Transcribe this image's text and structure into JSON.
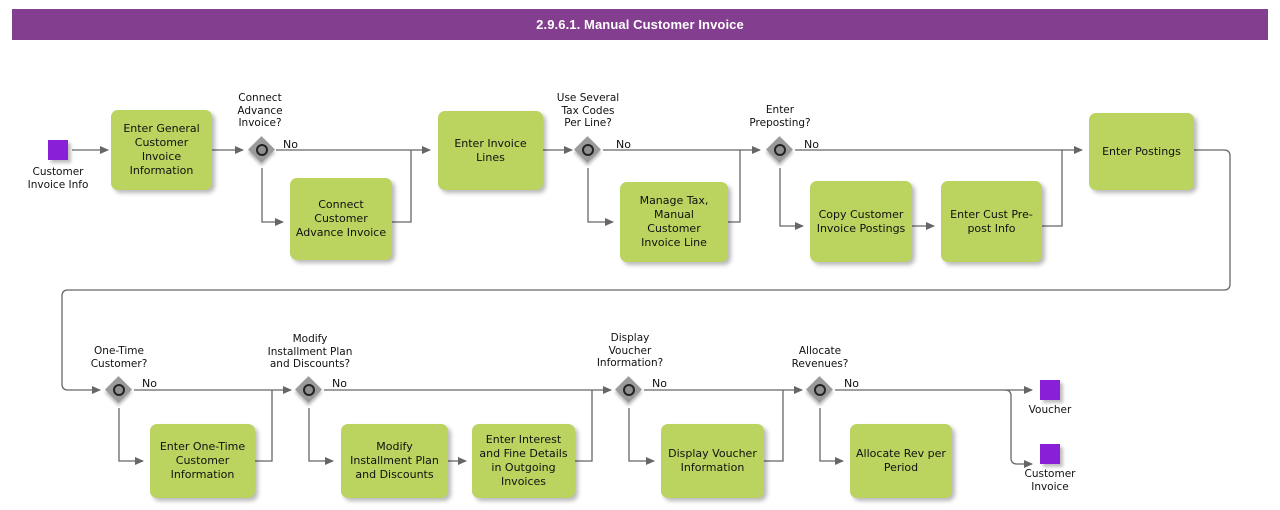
{
  "header": {
    "title": "2.9.6.1. Manual Customer Invoice",
    "bar_color": "#833e8f"
  },
  "palette": {
    "task_fill": "#bbd35f",
    "gateway_fill": "#9a9a9a",
    "marker_fill": "#8a1fd8",
    "connector": "#555555",
    "text": "#111111"
  },
  "markers": [
    {
      "id": "start-customer-invoice-info",
      "label": "Customer\nInvoice Info"
    },
    {
      "id": "end-voucher",
      "label": "Voucher"
    },
    {
      "id": "end-customer-invoice",
      "label": "Customer\nInvoice"
    }
  ],
  "gateways": [
    {
      "id": "gw-connect-advance-invoice",
      "label": "Connect\nAdvance\nInvoice?",
      "branch": "No"
    },
    {
      "id": "gw-use-several-tax-codes",
      "label": "Use Several\nTax Codes\nPer Line?",
      "branch": "No"
    },
    {
      "id": "gw-enter-preposting",
      "label": "Enter\nPreposting?",
      "branch": "No"
    },
    {
      "id": "gw-one-time-customer",
      "label": "One-Time\nCustomer?",
      "branch": "No"
    },
    {
      "id": "gw-modify-installment-plan",
      "label": "Modify\nInstallment Plan\nand Discounts?",
      "branch": "No"
    },
    {
      "id": "gw-display-voucher-information",
      "label": "Display\nVoucher\nInformation?",
      "branch": "No"
    },
    {
      "id": "gw-allocate-revenues",
      "label": "Allocate\nRevenues?",
      "branch": "No"
    }
  ],
  "tasks": [
    {
      "id": "task-enter-general-customer-invoice-information",
      "label": "Enter General\nCustomer\nInvoice\nInformation"
    },
    {
      "id": "task-connect-customer-advance-invoice",
      "label": "Connect\nCustomer\nAdvance Invoice"
    },
    {
      "id": "task-enter-invoice-lines",
      "label": "Enter Invoice\nLines"
    },
    {
      "id": "task-manage-tax-manual-customer-invoice-line",
      "label": "Manage Tax,\nManual\nCustomer\nInvoice Line"
    },
    {
      "id": "task-copy-customer-invoice-postings",
      "label": "Copy Customer\nInvoice Postings"
    },
    {
      "id": "task-enter-cust-prepost-info",
      "label": "Enter Cust Pre-\npost Info"
    },
    {
      "id": "task-enter-postings",
      "label": "Enter Postings"
    },
    {
      "id": "task-enter-one-time-customer-information",
      "label": "Enter One-Time\nCustomer\nInformation"
    },
    {
      "id": "task-modify-installment-plan-and-discounts",
      "label": "Modify\nInstallment Plan\nand Discounts"
    },
    {
      "id": "task-enter-interest-and-fine-details",
      "label": "Enter Interest\nand Fine Details\nin Outgoing\nInvoices"
    },
    {
      "id": "task-display-voucher-information",
      "label": "Display Voucher\nInformation"
    },
    {
      "id": "task-allocate-rev-per-period",
      "label": "Allocate Rev per\nPeriod"
    }
  ]
}
